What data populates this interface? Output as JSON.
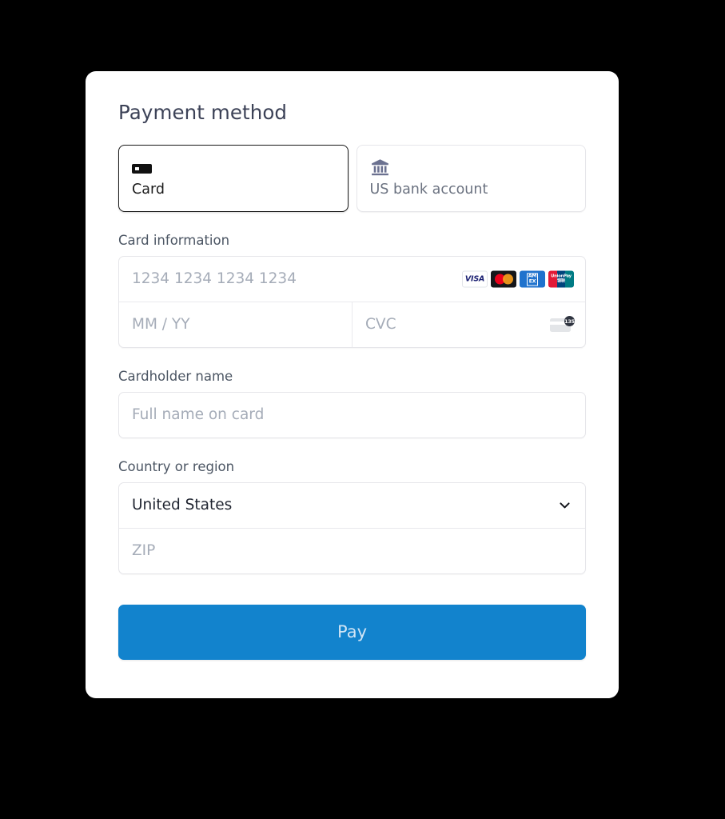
{
  "panel": {
    "title": "Payment method"
  },
  "method_tabs": [
    {
      "id": "card",
      "label": "Card",
      "icon": "credit-card-icon",
      "selected": true
    },
    {
      "id": "us-bank-account",
      "label": "US bank account",
      "icon": "bank-icon",
      "selected": false
    }
  ],
  "card_information": {
    "label": "Card information",
    "number_placeholder": "1234 1234 1234 1234",
    "expiry_placeholder": "MM / YY",
    "cvc_placeholder": "CVC",
    "cvc_hint_digits": "135",
    "brands": [
      {
        "id": "visa",
        "name": "VISA",
        "text": "VISA"
      },
      {
        "id": "mastercard",
        "name": "Mastercard",
        "text": ""
      },
      {
        "id": "amex",
        "name": "American Express",
        "line1": "AM",
        "line2": "EX"
      },
      {
        "id": "unionpay",
        "name": "UnionPay",
        "line1": "UnionPay",
        "line2": "银联"
      }
    ]
  },
  "cardholder": {
    "label": "Cardholder name",
    "placeholder": "Full name on card"
  },
  "country": {
    "label": "Country or region",
    "selected": "United States",
    "zip_placeholder": "ZIP"
  },
  "actions": {
    "pay_label": "Pay"
  },
  "colors": {
    "pay_button": "#1283cd",
    "selected_tab_border": "#1a1a1a",
    "field_border": "#e6e6ea",
    "placeholder": "#a5acb8",
    "background": "#000000"
  }
}
